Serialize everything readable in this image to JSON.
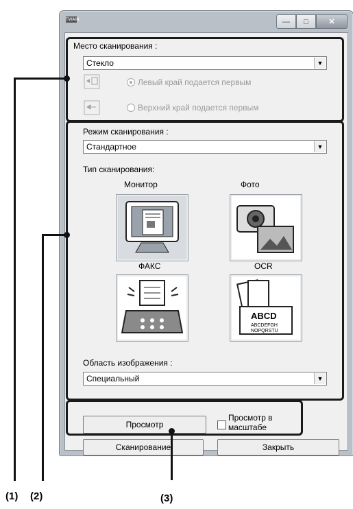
{
  "window": {
    "app_badge": "TWAIN"
  },
  "scan_location": {
    "label": "Место сканирования :",
    "value": "Стекло",
    "orient_left": "Левый край подается первым",
    "orient_top": "Верхний край подается первым"
  },
  "scan_mode": {
    "label": "Режим сканирования :",
    "value": "Стандартное",
    "type_label": "Тип сканирования:",
    "types": [
      {
        "label": "Монитор"
      },
      {
        "label": "Фото"
      },
      {
        "label": "ФАКС"
      },
      {
        "label": "OCR"
      }
    ],
    "area_label": "Область изображения :",
    "area_value": "Специальный"
  },
  "preview": {
    "button": "Просмотр",
    "zoom_check": "Просмотр в масштабе"
  },
  "footer": {
    "scan_button": "Сканирование",
    "close_button": "Закрыть"
  },
  "callouts": [
    "(1)",
    "(2)",
    "(3)"
  ],
  "colors": {
    "frame": "#b9c0c7",
    "client": "#f0f0f0",
    "callout": "#111111"
  },
  "icons": [
    "monitor-scan-icon",
    "photo-scan-icon",
    "fax-scan-icon",
    "ocr-scan-icon"
  ]
}
